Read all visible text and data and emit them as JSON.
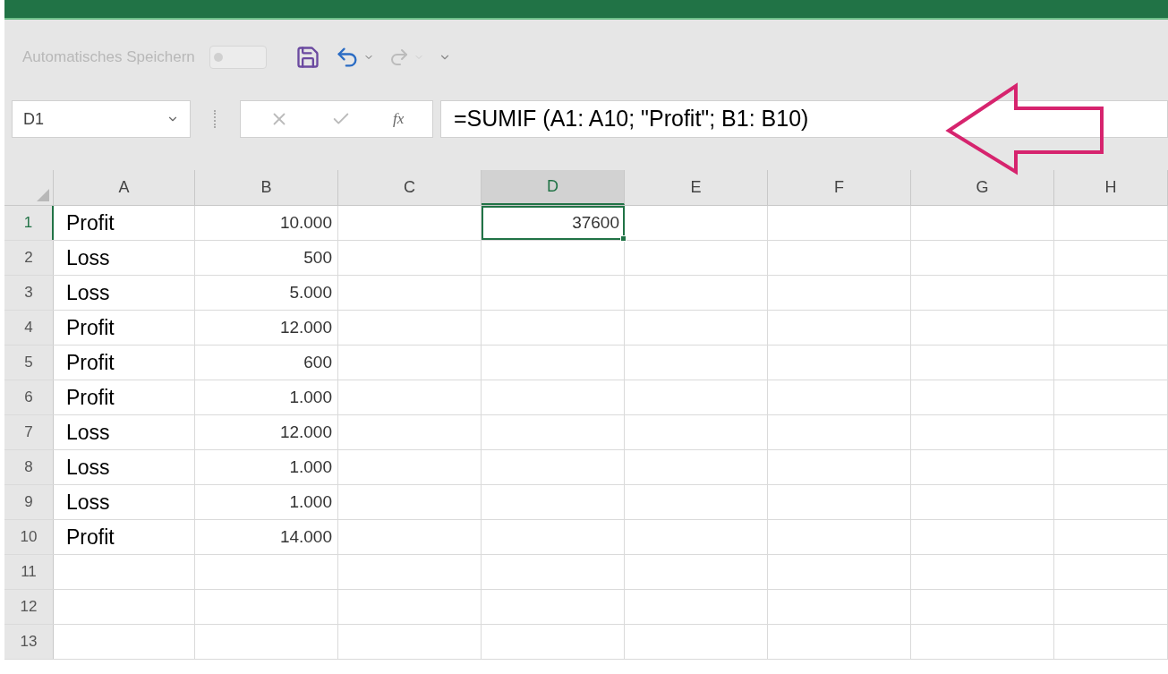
{
  "quick_access": {
    "autosave_label": "Automatisches Speichern",
    "autosave_on": false
  },
  "name_box": {
    "value": "D1"
  },
  "formula_bar": {
    "function_label": "fx",
    "value": "=SUMIF (A1: A10; \"Profit\"; B1: B10)"
  },
  "columns": [
    {
      "label": "A",
      "selected": false
    },
    {
      "label": "B",
      "selected": false
    },
    {
      "label": "C",
      "selected": false
    },
    {
      "label": "D",
      "selected": true
    },
    {
      "label": "E",
      "selected": false
    },
    {
      "label": "F",
      "selected": false
    },
    {
      "label": "G",
      "selected": false
    },
    {
      "label": "H",
      "selected": false
    }
  ],
  "selected_cell": {
    "value": "37600"
  },
  "rows": [
    {
      "label": "1",
      "selected": true,
      "a": "Profit",
      "b": "10.000"
    },
    {
      "label": "2",
      "selected": false,
      "a": "Loss",
      "b": "500"
    },
    {
      "label": "3",
      "selected": false,
      "a": "Loss",
      "b": "5.000"
    },
    {
      "label": "4",
      "selected": false,
      "a": "Profit",
      "b": "12.000"
    },
    {
      "label": "5",
      "selected": false,
      "a": "Profit",
      "b": "600"
    },
    {
      "label": "6",
      "selected": false,
      "a": "Profit",
      "b": "1.000"
    },
    {
      "label": "7",
      "selected": false,
      "a": "Loss",
      "b": "12.000"
    },
    {
      "label": "8",
      "selected": false,
      "a": "Loss",
      "b": "1.000"
    },
    {
      "label": "9",
      "selected": false,
      "a": "Loss",
      "b": "1.000"
    },
    {
      "label": "10",
      "selected": false,
      "a": "Profit",
      "b": "14.000"
    },
    {
      "label": "11",
      "selected": false
    },
    {
      "label": "12",
      "selected": false
    },
    {
      "label": "13",
      "selected": false
    }
  ]
}
